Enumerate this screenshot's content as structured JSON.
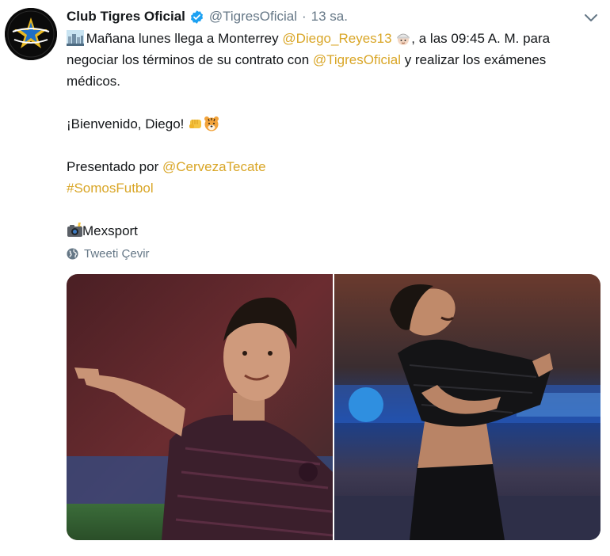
{
  "tweet": {
    "display_name": "Club Tigres Oficial",
    "handle": "@TigresOficial",
    "separator": "·",
    "time": "13 sa.",
    "line1": {
      "text_a": "Mañana lunes llega a Monterrey ",
      "mention1": "@Diego_Reyes13",
      "text_b": ", a las 09:45 A. M. para negociar los términos de su contrato con ",
      "mention2": "@TigresOficial",
      "text_c": " y realizar los exámenes médicos."
    },
    "welcome": "¡Bienvenido, Diego!",
    "presented_by": "Presentado por ",
    "sponsor_mention": "@CervezaTecate",
    "hashtag": "#SomosFutbol",
    "photo_credit": "Mexsport",
    "translate_label": "Tweeti Çevir"
  },
  "icons": {
    "verified": "verified-badge-icon",
    "caret": "chevron-down-icon",
    "city": "city-sunrise-emoji-icon",
    "face": "construction-worker-emoji-icon",
    "fist": "raised-fist-emoji-icon",
    "tiger": "tiger-face-emoji-icon",
    "camera": "camera-flash-emoji-icon",
    "globe": "globe-icon"
  },
  "colors": {
    "link": "#d9a627",
    "secondary": "#657786",
    "text": "#14171a",
    "verified": "#1da1f2"
  }
}
